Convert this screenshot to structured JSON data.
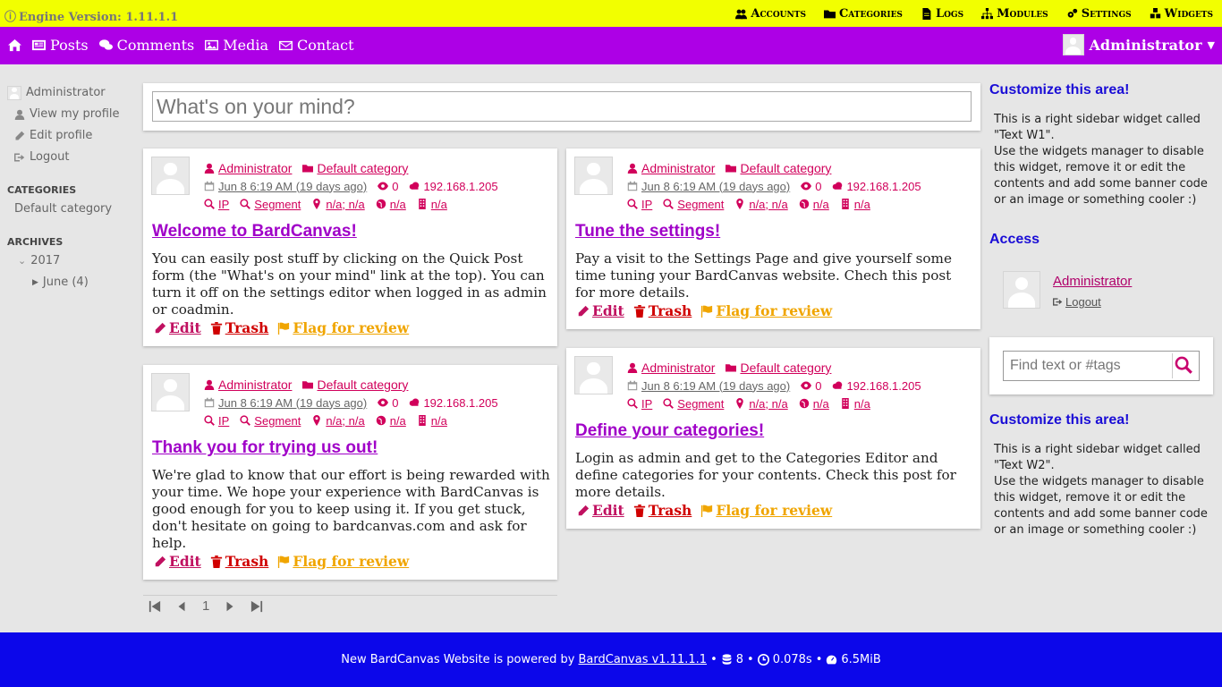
{
  "adminbar": {
    "version": "Engine Version: 1.11.1.1",
    "menu": [
      {
        "label": "Accounts",
        "icon": "users-icon"
      },
      {
        "label": "Categories",
        "icon": "folder-icon"
      },
      {
        "label": "Logs",
        "icon": "file-icon"
      },
      {
        "label": "Modules",
        "icon": "sitemap-icon"
      },
      {
        "label": "Settings",
        "icon": "gears-icon"
      },
      {
        "label": "Widgets",
        "icon": "cubes-icon"
      }
    ]
  },
  "mainnav": {
    "items": [
      {
        "label": "Posts"
      },
      {
        "label": "Comments"
      },
      {
        "label": "Media"
      },
      {
        "label": "Contact"
      }
    ],
    "user": "Administrator"
  },
  "leftbar": {
    "user": "Administrator",
    "view_profile": "View my profile",
    "edit_profile": "Edit profile",
    "logout": "Logout",
    "categories_title": "CATEGORIES",
    "categories": [
      "Default category"
    ],
    "archives_title": "ARCHIVES",
    "year": "2017",
    "month": "June (4)"
  },
  "quickpost": {
    "placeholder": "What's on your mind?"
  },
  "posts": [
    {
      "author": "Administrator",
      "category": "Default category",
      "date": "Jun 8 6:19 AM (19 days ago)",
      "views": "0",
      "ip": "192.168.1.205",
      "ip_link": "IP",
      "segment": "Segment",
      "location": "n/a; n/a",
      "globe": "n/a",
      "isp": "n/a",
      "title": "Welcome to BardCanvas!",
      "excerpt": "You can easily post stuff by clicking on the Quick Post form (the \"What's on your mind\" link at the top). You can turn it off on the settings editor when logged in as admin or coadmin."
    },
    {
      "author": "Administrator",
      "category": "Default category",
      "date": "Jun 8 6:19 AM (19 days ago)",
      "views": "0",
      "ip": "192.168.1.205",
      "ip_link": "IP",
      "segment": "Segment",
      "location": "n/a; n/a",
      "globe": "n/a",
      "isp": "n/a",
      "title": "Tune the settings!",
      "excerpt": "Pay a visit to the Settings Page and give yourself some time tuning your BardCanvas website. Chech this post for more details."
    },
    {
      "author": "Administrator",
      "category": "Default category",
      "date": "Jun 8 6:19 AM (19 days ago)",
      "views": "0",
      "ip": "192.168.1.205",
      "ip_link": "IP",
      "segment": "Segment",
      "location": "n/a; n/a",
      "globe": "n/a",
      "isp": "n/a",
      "title": "Thank you for trying us out!",
      "excerpt": "We're glad to know that our effort is being rewarded with your time. We hope your experience with BardCanvas is good enough for you to keep using it. If you get stuck, don't hesitate on going to bardcanvas.com and ask for help."
    },
    {
      "author": "Administrator",
      "category": "Default category",
      "date": "Jun 8 6:19 AM (19 days ago)",
      "views": "0",
      "ip": "192.168.1.205",
      "ip_link": "IP",
      "segment": "Segment",
      "location": "n/a; n/a",
      "globe": "n/a",
      "isp": "n/a",
      "title": "Define your categories!",
      "excerpt": "Login as admin and get to the Categories Editor and define categories for your contents. Check this post for more details."
    }
  ],
  "actions": {
    "edit": "Edit",
    "trash": "Trash",
    "flag": "Flag for review"
  },
  "pager": {
    "page": "1"
  },
  "rightbar": {
    "w1_title": "Customize this area!",
    "w1_text1": "This is a right sidebar widget called \"Text W1\".",
    "w1_text2": "Use the widgets manager to disable this widget, remove it or edit the contents and add some banner code or an image or something cooler :)",
    "access_title": "Access",
    "access_user": "Administrator",
    "access_logout": "Logout",
    "search_placeholder": "Find text or #tags",
    "w2_title": "Customize this area!",
    "w2_text1": "This is a right sidebar widget called \"Text W2\".",
    "w2_text2": "Use the widgets manager to disable this widget, remove it or edit the contents and add some banner code or an image or something cooler :)"
  },
  "footer": {
    "prefix": "New BardCanvas Website is powered by",
    "link": "BardCanvas v1.11.1.1",
    "queries": "8",
    "time": "0.078s",
    "memory": "6.5MiB"
  },
  "colors": {
    "adminbar_bg": "#f2ff00",
    "nav_bg": "#ad00e6",
    "footer_bg": "#0c07ea",
    "title_purple": "#a000c8",
    "meta_pink": "#d1005b"
  }
}
